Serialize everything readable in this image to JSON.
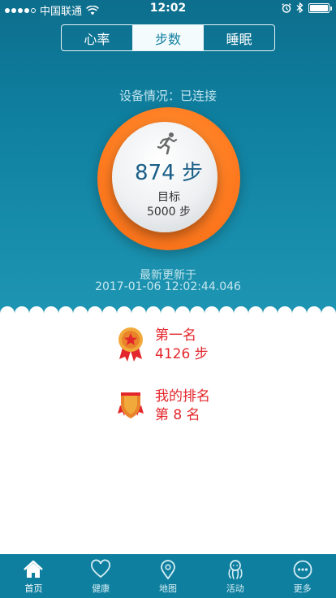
{
  "statusbar": {
    "carrier": "中国联通",
    "time": "12:02"
  },
  "tabs_top": [
    {
      "label": "心率",
      "active": false
    },
    {
      "label": "步数",
      "active": true
    },
    {
      "label": "睡眠",
      "active": false
    }
  ],
  "device": {
    "status": "设备情况：已连接"
  },
  "steps": {
    "value": "874 步",
    "goal_label": "目标",
    "goal_value": "5000 步"
  },
  "updated": {
    "label": "最新更新于",
    "time": "2017-01-06 12:02:44.046"
  },
  "rank": {
    "first": {
      "title": "第一名",
      "value": "4126 步"
    },
    "mine": {
      "title": "我的排名",
      "value": "第 8 名"
    }
  },
  "tabbar": [
    {
      "label": "首页",
      "icon": "home-icon",
      "active": true
    },
    {
      "label": "健康",
      "icon": "heart-icon",
      "active": false
    },
    {
      "label": "地图",
      "icon": "map-pin-icon",
      "active": false
    },
    {
      "label": "活动",
      "icon": "activity-icon",
      "active": false
    },
    {
      "label": "更多",
      "icon": "more-icon",
      "active": false
    }
  ],
  "colors": {
    "teal": "#0f7f9f",
    "orange": "#ff7a1f",
    "red": "#e3262b"
  }
}
